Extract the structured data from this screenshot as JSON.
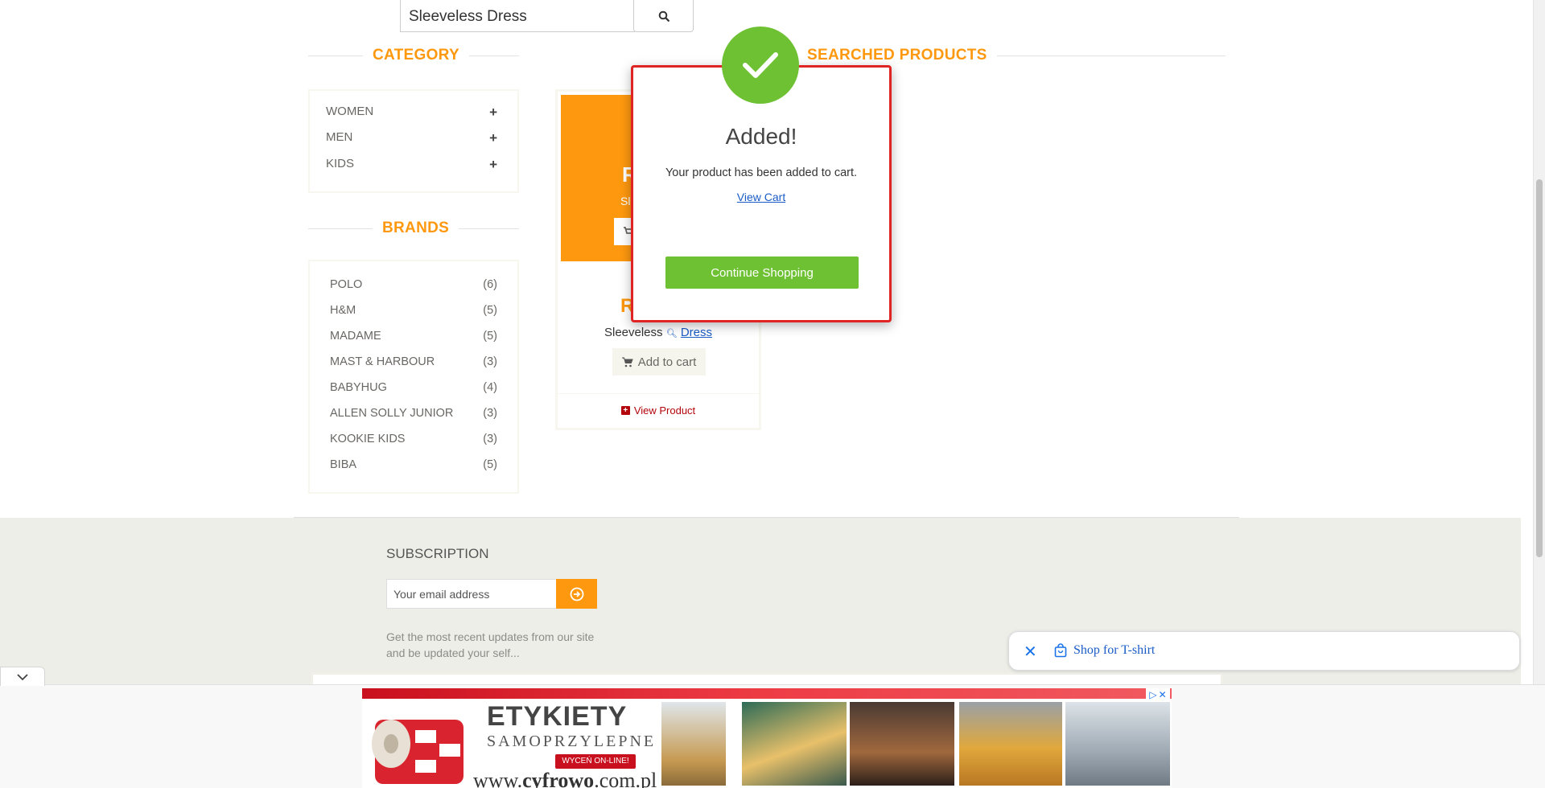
{
  "search": {
    "value": "Sleeveless Dress",
    "button_icon": "search-icon"
  },
  "sidebar": {
    "category_title": "CATEGORY",
    "categories": [
      {
        "label": "WOMEN",
        "icon": "+"
      },
      {
        "label": "MEN",
        "icon": "+"
      },
      {
        "label": "KIDS",
        "icon": "+"
      }
    ],
    "brands_title": "BRANDS",
    "brands": [
      {
        "label": "POLO",
        "count": "(6)"
      },
      {
        "label": "H&M",
        "count": "(5)"
      },
      {
        "label": "MADAME",
        "count": "(5)"
      },
      {
        "label": "MAST & HARBOUR",
        "count": "(3)"
      },
      {
        "label": "BABYHUG",
        "count": "(4)"
      },
      {
        "label": "ALLEN SOLLY JUNIOR",
        "count": "(3)"
      },
      {
        "label": "KOOKIE KIDS",
        "count": "(3)"
      },
      {
        "label": "BIBA",
        "count": "(5)"
      }
    ]
  },
  "main": {
    "title": "SEARCHED PRODUCTS",
    "product": {
      "overlay_price": "R",
      "overlay_name": "Sle",
      "price": "R",
      "name": "Sleeveless",
      "name_link": "Dress",
      "add_to_cart": "Add to cart",
      "view_product": "View Product"
    }
  },
  "modal": {
    "title": "Added!",
    "message": "Your product has been added to cart.",
    "view_cart": "View Cart",
    "continue": "Continue Shopping"
  },
  "footer": {
    "subscription_title": "SUBSCRIPTION",
    "email_placeholder": "Your email address",
    "description": "Get the most recent updates from our site and be updated your self..."
  },
  "shop_pill": {
    "label": "Shop for T-shirt"
  },
  "ad": {
    "title": "ETYKIETY",
    "subtitle": "SAMOPRZYLEPNE",
    "cta": "WYCEŃ ON-LINE!",
    "url_prefix": "www.",
    "url_brand": "cyfrowo",
    "url_suffix": ".com.pl"
  },
  "colors": {
    "accent": "#FE980F",
    "success": "#6FC134",
    "modal_border": "#E02424",
    "link": "#1a5cc7",
    "footer_bg": "#EEEEE8"
  }
}
